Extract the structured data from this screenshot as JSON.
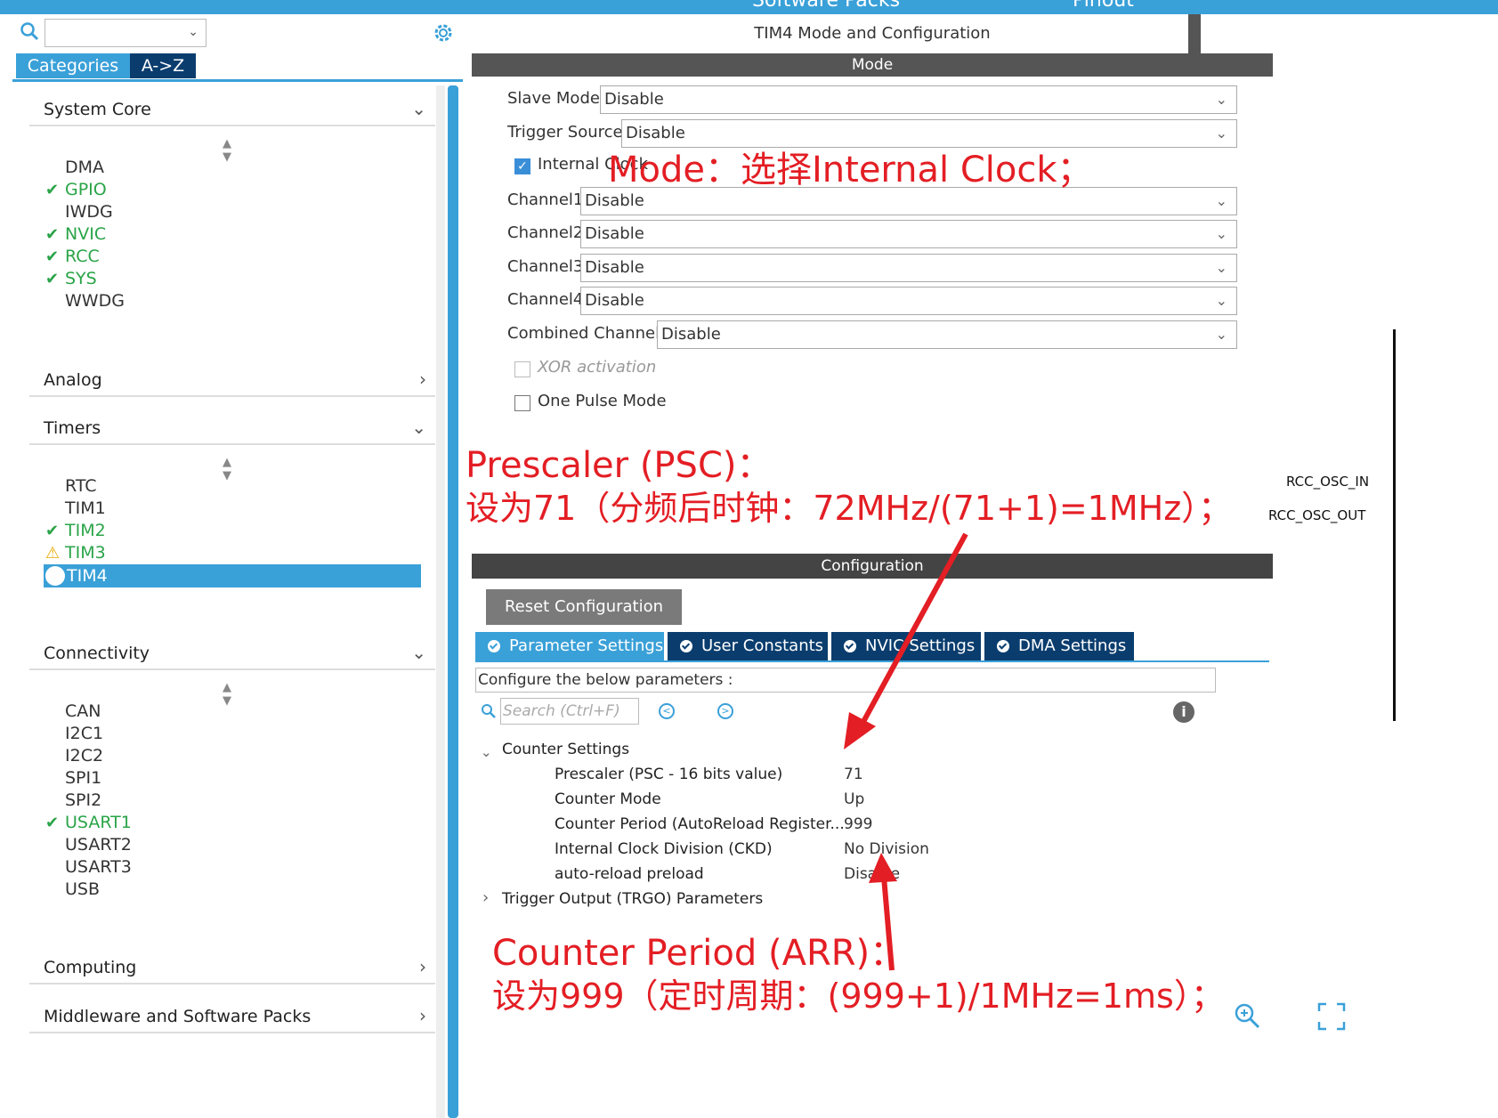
{
  "topbar": {
    "left_label": "Software Packs",
    "right_label": "Pinout"
  },
  "sidebar": {
    "search_value": "",
    "tab_categories": "Categories",
    "tab_az": "A->Z",
    "sections": {
      "system_core": "System Core",
      "analog": "Analog",
      "timers": "Timers",
      "connectivity": "Connectivity",
      "computing": "Computing",
      "middleware": "Middleware and Software Packs"
    },
    "system_core_items": [
      "DMA",
      "GPIO",
      "IWDG",
      "NVIC",
      "RCC",
      "SYS",
      "WWDG"
    ],
    "timer_items": [
      "RTC",
      "TIM1",
      "TIM2",
      "TIM3",
      "TIM4"
    ],
    "connectivity_items": [
      "CAN",
      "I2C1",
      "I2C2",
      "SPI1",
      "SPI2",
      "USART1",
      "USART2",
      "USART3",
      "USB"
    ]
  },
  "panel": {
    "title": "TIM4 Mode and Configuration",
    "mode_header": "Mode",
    "config_header": "Configuration",
    "slave_mode_label": "Slave Mode",
    "slave_mode_value": "Disable",
    "trigger_source_label": "Trigger Source",
    "trigger_source_value": "Disable",
    "internal_clock_label": "Internal Clock",
    "channel1_label": "Channel1",
    "channel1_value": "Disable",
    "channel2_label": "Channel2",
    "channel2_value": "Disable",
    "channel3_label": "Channel3",
    "channel3_value": "Disable",
    "channel4_label": "Channel4",
    "channel4_value": "Disable",
    "combined_label": "Combined Channels",
    "combined_value": "Disable",
    "xor_label": "XOR activation",
    "one_pulse_label": "One Pulse Mode",
    "reset_button": "Reset Configuration",
    "tabs": [
      "Parameter Settings",
      "User Constants",
      "NVIC Settings",
      "DMA Settings"
    ],
    "configure_line": "Configure the below parameters :",
    "search_placeholder": "Search (Ctrl+F)",
    "counter_settings": "Counter Settings",
    "params": [
      {
        "name": "Prescaler (PSC - 16 bits value)",
        "value": "71"
      },
      {
        "name": "Counter Mode",
        "value": "Up"
      },
      {
        "name": "Counter Period (AutoReload Register...",
        "value": "999"
      },
      {
        "name": "Internal Clock Division (CKD)",
        "value": "No Division"
      },
      {
        "name": "auto-reload preload",
        "value": "Disable"
      }
    ],
    "trgo": "Trigger Output (TRGO) Parameters"
  },
  "pins": {
    "osc_in": "RCC_OSC_IN",
    "osc_out": "RCC_OSC_OUT"
  },
  "annotations": {
    "mode": "Mode：选择Internal Clock；",
    "psc_title": "Prescaler (PSC)：",
    "psc_desc": "设为71（分频后时钟：72MHz/(71+1)=1MHz）；",
    "arr_title": "Counter Period (ARR)：",
    "arr_desc": "设为999（定时周期：(999+1)/1MHz=1ms）；"
  },
  "colors": {
    "accent": "#3aa0d8",
    "dark_tab": "#0a3d6e",
    "ok_green": "#2aa448",
    "annotation_red": "#e31e24"
  }
}
